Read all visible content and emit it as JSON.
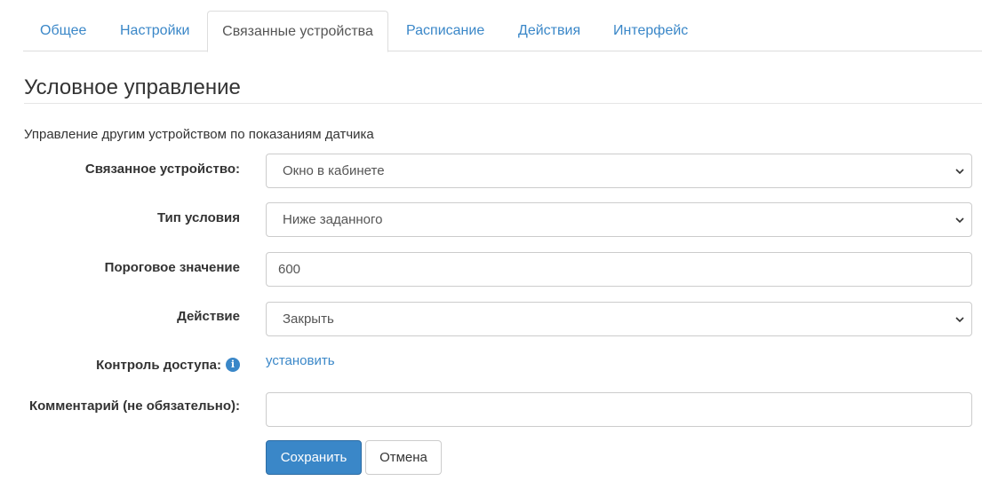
{
  "tabs": [
    {
      "label": "Общее"
    },
    {
      "label": "Настройки"
    },
    {
      "label": "Связанные устройства"
    },
    {
      "label": "Расписание"
    },
    {
      "label": "Действия"
    },
    {
      "label": "Интерфейс"
    }
  ],
  "active_tab": "Связанные устройства",
  "section": {
    "title": "Условное управление",
    "description": "Управление другим устройством по показаниям датчика"
  },
  "form": {
    "linked_device": {
      "label": "Связанное устройство:",
      "value": "Окно в кабинете"
    },
    "condition_type": {
      "label": "Тип условия",
      "value": "Ниже заданного"
    },
    "threshold": {
      "label": "Пороговое значение",
      "value": "600"
    },
    "action": {
      "label": "Действие",
      "value": "Закрыть"
    },
    "access_control": {
      "label": "Контроль доступа:",
      "link": "установить",
      "icon": "info-icon"
    },
    "comment": {
      "label": "Комментарий (не обязательно):",
      "value": ""
    }
  },
  "buttons": {
    "save": "Сохранить",
    "cancel": "Отмена"
  },
  "colors": {
    "accent": "#3a87c8",
    "text": "#333333",
    "border": "#cccccc"
  }
}
